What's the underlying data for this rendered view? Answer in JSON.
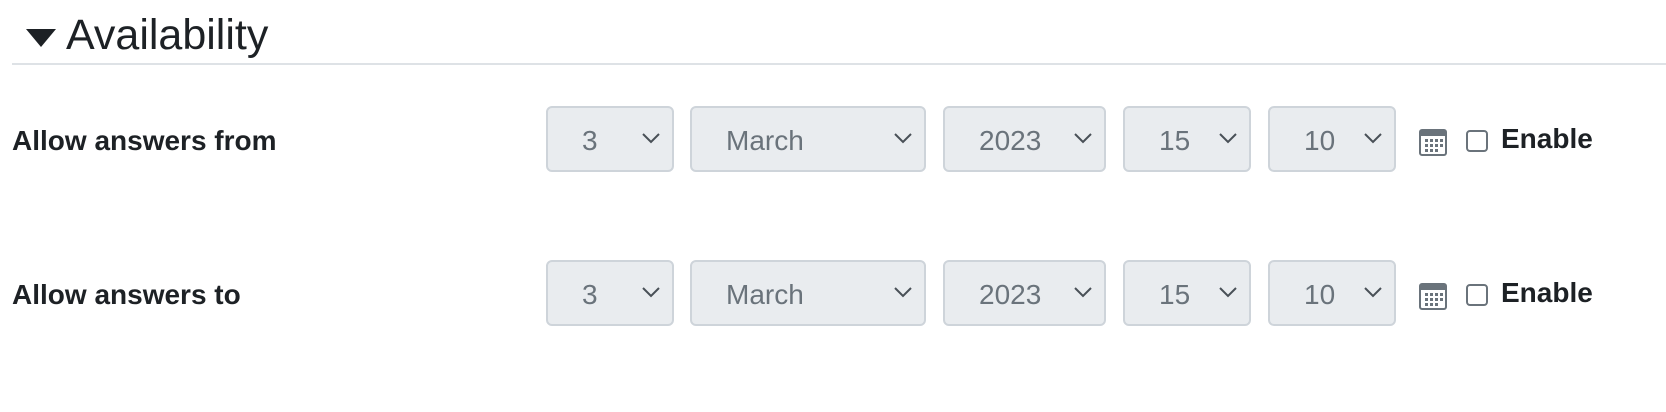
{
  "section": {
    "title": "Availability",
    "toggle_icon": "caret-down-icon"
  },
  "rows": [
    {
      "label": "Allow answers from",
      "day": "3",
      "month": "March",
      "year": "2023",
      "hour": "15",
      "minute": "10",
      "calendar_icon": "calendar-icon",
      "enable_label": "Enable",
      "enabled": false
    },
    {
      "label": "Allow answers to",
      "day": "3",
      "month": "March",
      "year": "2023",
      "hour": "15",
      "minute": "10",
      "calendar_icon": "calendar-icon",
      "enable_label": "Enable",
      "enabled": false
    }
  ],
  "colors": {
    "select_bg": "#e9ecef",
    "select_border": "#ced4da",
    "select_text": "#6a737b",
    "text": "#1d2125",
    "calendar": "#6a737b"
  }
}
